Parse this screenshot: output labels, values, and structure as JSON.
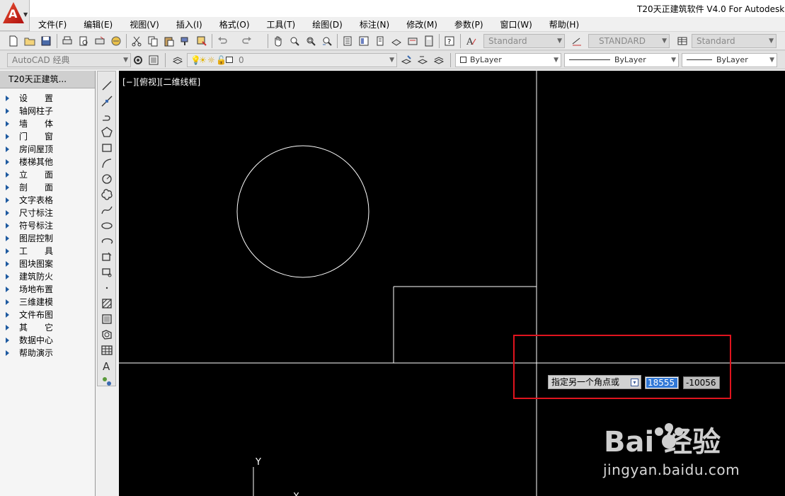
{
  "window": {
    "title": "T20天正建筑软件 V4.0 For Autodesk ..."
  },
  "app_menu": {
    "letter": "A"
  },
  "menu": [
    "文件(F)",
    "编辑(E)",
    "视图(V)",
    "插入(I)",
    "格式(O)",
    "工具(T)",
    "绘图(D)",
    "标注(N)",
    "修改(M)",
    "参数(P)",
    "窗口(W)",
    "帮助(H)"
  ],
  "toolbar1": {
    "text_style": "Standard",
    "dim_style": "STANDARD",
    "table_style": "Standard"
  },
  "toolbar2": {
    "workspace": "AutoCAD 经典",
    "layer": "0",
    "color": "ByLayer",
    "linetype": "ByLayer",
    "lineweight": "ByLayer"
  },
  "side_panel": {
    "title": "T20天正建筑...",
    "items": [
      "设　　置",
      "轴网柱子",
      "墙　　体",
      "门　　窗",
      "房间屋顶",
      "楼梯其他",
      "立　　面",
      "剖　　面",
      "文字表格",
      "尺寸标注",
      "符号标注",
      "图层控制",
      "工　　具",
      "图块图案",
      "建筑防火",
      "场地布置",
      "三维建模",
      "文件布图",
      "其　　它",
      "数据中心",
      "帮助演示"
    ]
  },
  "canvas": {
    "viewport_label": "[−][俯视][二维线框]",
    "prompt": "指定另一个角点或",
    "coord_x": "18555",
    "coord_y": "-10056",
    "ucs_y": "Y",
    "ucs_x": "X"
  },
  "watermark": {
    "brand": "Bai 经验",
    "url": "jingyan.baidu.com"
  },
  "colors": {
    "highlight": "#e0141e",
    "canvas_bg": "#000000",
    "selection": "#3077d5"
  }
}
